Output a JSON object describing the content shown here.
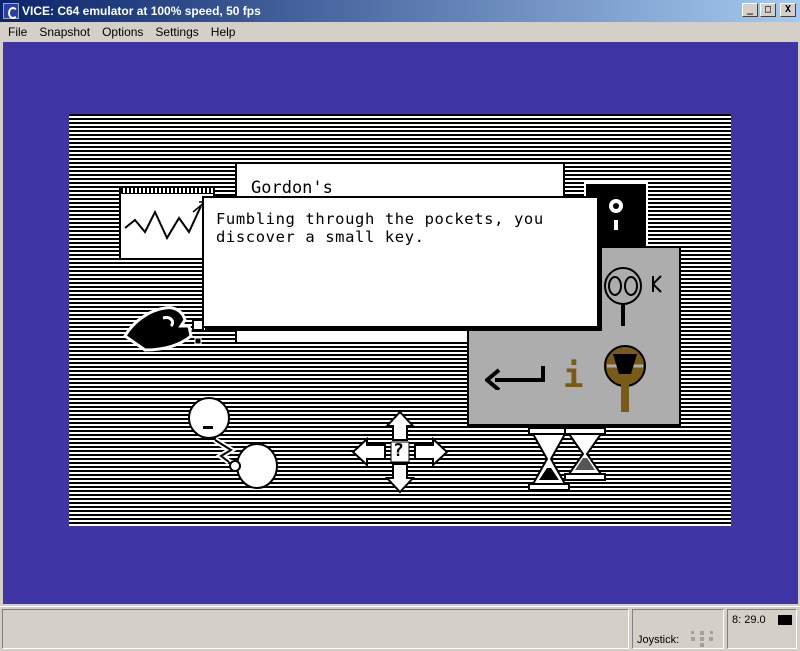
{
  "window": {
    "title": "VICE: C64 emulator at 100% speed, 50 fps",
    "buttons": {
      "minimize": "_",
      "maximize": "□",
      "close": "X"
    }
  },
  "menu": [
    {
      "label": "File"
    },
    {
      "label": "Snapshot"
    },
    {
      "label": "Options"
    },
    {
      "label": "Settings"
    },
    {
      "label": "Help"
    }
  ],
  "game": {
    "window_title": "Gordon's",
    "message": "Fumbling through the pockets, you discover a small key.",
    "panel_info_glyph": "i",
    "direction_pad_glyph": "?",
    "colors": {
      "screen_border": "#4035a5",
      "panel": "#adadad",
      "accent": "#7a5a18"
    }
  },
  "statusbar": {
    "joystick_label": "Joystick:",
    "clock": "8: 29.0"
  }
}
